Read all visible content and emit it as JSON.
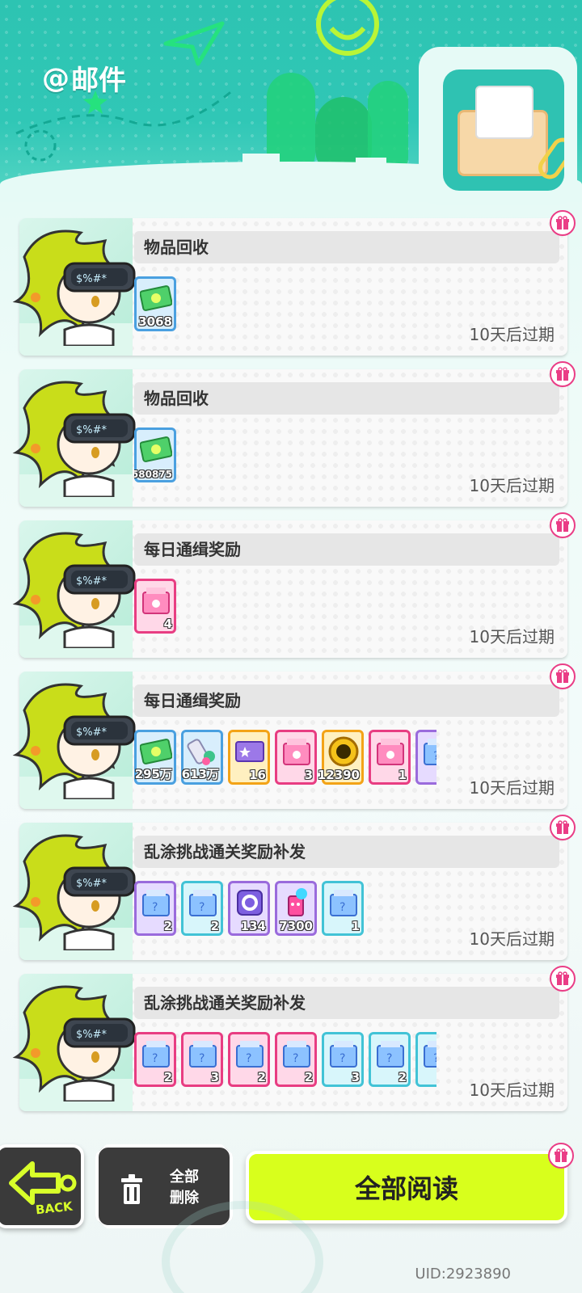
{
  "header": {
    "title_prefix": "@",
    "title": "邮件"
  },
  "mails": [
    {
      "subject": "物品回收",
      "expiry": "10天后过期",
      "items": [
        {
          "icon": "cash-icon",
          "count": "3068",
          "frame": "blue"
        }
      ]
    },
    {
      "subject": "物品回收",
      "expiry": "10天后过期",
      "items": [
        {
          "icon": "cash-icon",
          "count": "580875",
          "frame": "blue"
        }
      ]
    },
    {
      "subject": "每日通缉奖励",
      "expiry": "10天后过期",
      "items": [
        {
          "icon": "pink-milk-box-icon",
          "count": "4",
          "frame": "pink"
        }
      ]
    },
    {
      "subject": "每日通缉奖励",
      "expiry": "10天后过期",
      "items": [
        {
          "icon": "cash-icon",
          "count": "295万",
          "frame": "blue"
        },
        {
          "icon": "paint-tube-icon",
          "count": "613万",
          "frame": "blue"
        },
        {
          "icon": "purple-ticket-icon",
          "count": "16",
          "frame": "gold"
        },
        {
          "icon": "pink-milk-box-icon",
          "count": "3",
          "frame": "pink"
        },
        {
          "icon": "gold-coin-icon",
          "count": "12390",
          "frame": "gold"
        },
        {
          "icon": "pink-milk-box-icon",
          "count": "1",
          "frame": "pink"
        },
        {
          "icon": "blue-milk-box-icon",
          "count": "",
          "frame": "purple"
        }
      ]
    },
    {
      "subject": "乱涂挑战通关奖励补发",
      "expiry": "10天后过期",
      "items": [
        {
          "icon": "blue-milk-box-icon",
          "count": "2",
          "frame": "purple"
        },
        {
          "icon": "blue-milk-box-icon",
          "count": "2",
          "frame": "teal"
        },
        {
          "icon": "purple-lens-icon",
          "count": "134",
          "frame": "purple"
        },
        {
          "icon": "spray-can-icon",
          "count": "7300",
          "frame": "purple"
        },
        {
          "icon": "blue-milk-box-icon",
          "count": "1",
          "frame": "teal"
        }
      ]
    },
    {
      "subject": "乱涂挑战通关奖励补发",
      "expiry": "10天后过期",
      "items": [
        {
          "icon": "blue-milk-box-icon",
          "count": "2",
          "frame": "pink"
        },
        {
          "icon": "blue-milk-box-icon",
          "count": "3",
          "frame": "pink"
        },
        {
          "icon": "blue-milk-box-icon",
          "count": "2",
          "frame": "pink"
        },
        {
          "icon": "blue-milk-box-icon",
          "count": "2",
          "frame": "pink"
        },
        {
          "icon": "blue-milk-box-icon",
          "count": "3",
          "frame": "teal"
        },
        {
          "icon": "blue-milk-box-icon",
          "count": "2",
          "frame": "teal"
        },
        {
          "icon": "blue-milk-box-icon",
          "count": "",
          "frame": "teal"
        }
      ]
    }
  ],
  "footer": {
    "back_label": "BACK",
    "delete_line1": "全部",
    "delete_line2": "删除",
    "read_all_label": "全部阅读",
    "uid": "UID:2923890"
  },
  "colors": {
    "header_teal": "#2dc4b2",
    "accent_lime": "#d8ff1c",
    "gift_pink": "#ea3d86"
  }
}
